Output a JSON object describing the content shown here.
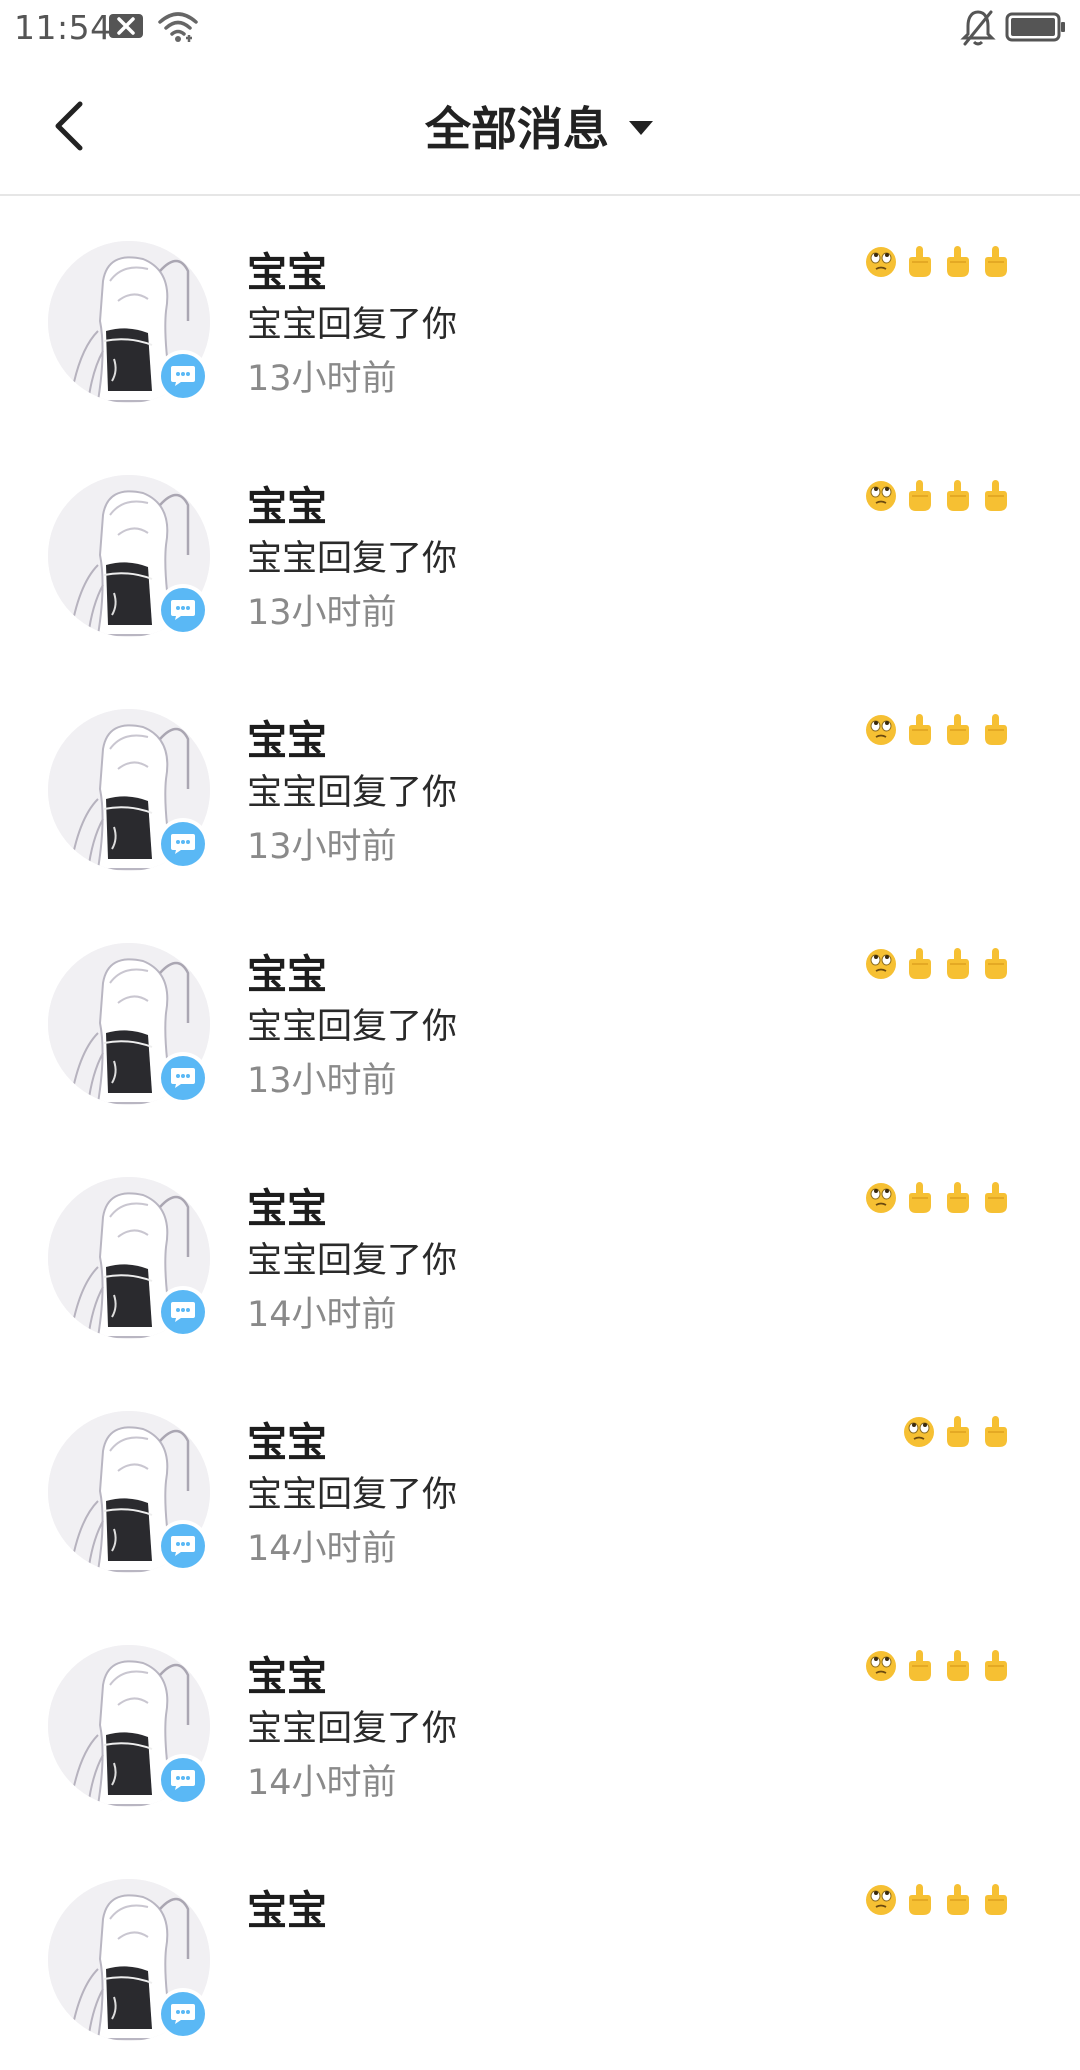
{
  "status_bar": {
    "time": "11:54",
    "icons": [
      "notification-x-icon",
      "wifi-icon",
      "bell-muted-icon",
      "battery-icon"
    ]
  },
  "header": {
    "back_icon": "chevron-left-icon",
    "title": "全部消息",
    "dropdown_icon": "caret-down-icon"
  },
  "colors": {
    "badge": "#5ab8f5",
    "divider": "#e6e6e6",
    "time_text": "#8a8a8a",
    "emoji": "#f6c033"
  },
  "messages": [
    {
      "name": "宝宝",
      "text": "宝宝回复了你",
      "time": "13小时前",
      "reactions": [
        "eye-roll",
        "finger",
        "finger",
        "finger"
      ]
    },
    {
      "name": "宝宝",
      "text": "宝宝回复了你",
      "time": "13小时前",
      "reactions": [
        "eye-roll",
        "finger",
        "finger",
        "finger"
      ]
    },
    {
      "name": "宝宝",
      "text": "宝宝回复了你",
      "time": "13小时前",
      "reactions": [
        "eye-roll",
        "finger",
        "finger",
        "finger"
      ]
    },
    {
      "name": "宝宝",
      "text": "宝宝回复了你",
      "time": "13小时前",
      "reactions": [
        "eye-roll",
        "finger",
        "finger",
        "finger"
      ]
    },
    {
      "name": "宝宝",
      "text": "宝宝回复了你",
      "time": "14小时前",
      "reactions": [
        "eye-roll",
        "finger",
        "finger",
        "finger"
      ]
    },
    {
      "name": "宝宝",
      "text": "宝宝回复了你",
      "time": "14小时前",
      "reactions": [
        "eye-roll",
        "finger",
        "finger"
      ]
    },
    {
      "name": "宝宝",
      "text": "宝宝回复了你",
      "time": "14小时前",
      "reactions": [
        "eye-roll",
        "finger",
        "finger",
        "finger"
      ]
    },
    {
      "name": "宝宝",
      "text": "",
      "time": "",
      "reactions": [
        "eye-roll",
        "finger",
        "finger",
        "finger"
      ]
    }
  ]
}
